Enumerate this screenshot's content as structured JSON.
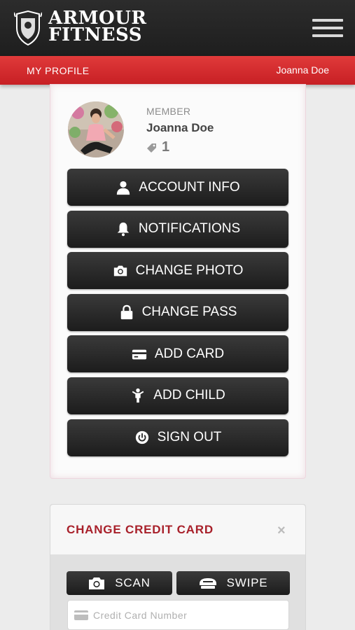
{
  "header": {
    "brand_line1": "ARMOUR",
    "brand_line2": "FITNESS",
    "logo_icon": "crest-shield-icon",
    "menu_icon": "hamburger-menu-icon"
  },
  "subheader": {
    "section_title": "MY PROFILE",
    "user_name": "Joanna Doe"
  },
  "profile": {
    "role_label": "MEMBER",
    "name": "Joanna Doe",
    "count": "1",
    "count_icon": "tag-icon"
  },
  "menu": {
    "items": [
      {
        "label": "ACCOUNT INFO",
        "icon": "user-icon"
      },
      {
        "label": "NOTIFICATIONS",
        "icon": "bell-icon"
      },
      {
        "label": "CHANGE PHOTO",
        "icon": "camera-icon"
      },
      {
        "label": "CHANGE PASS",
        "icon": "lock-icon"
      },
      {
        "label": "ADD CARD",
        "icon": "credit-card-icon"
      },
      {
        "label": "ADD CHILD",
        "icon": "child-icon"
      },
      {
        "label": "SIGN OUT",
        "icon": "power-icon"
      }
    ]
  },
  "credit_card_panel": {
    "title": "CHANGE CREDIT CARD",
    "close": "×",
    "scan_label": "SCAN",
    "swipe_label": "SWIPE",
    "card_number_placeholder": "Credit Card Number"
  },
  "colors": {
    "brand_red": "#c71f24",
    "title_red": "#a8202a",
    "dark_button": "#262626"
  }
}
